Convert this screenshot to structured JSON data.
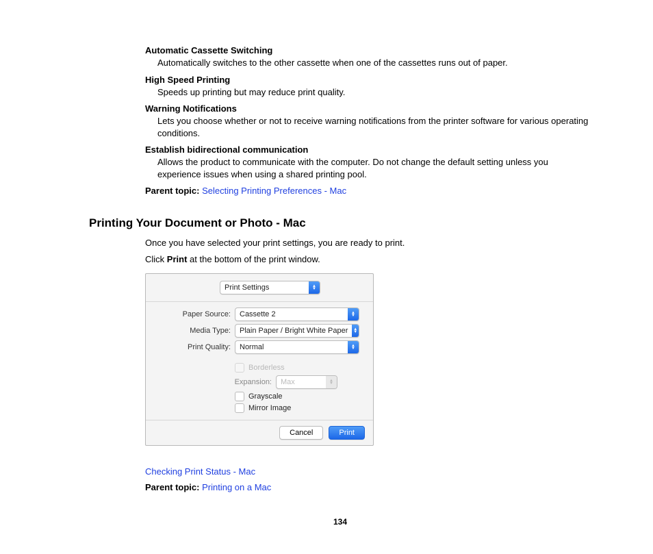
{
  "defs": [
    {
      "term": "Automatic Cassette Switching",
      "desc": "Automatically switches to the other cassette when one of the cassettes runs out of paper."
    },
    {
      "term": "High Speed Printing",
      "desc": "Speeds up printing but may reduce print quality."
    },
    {
      "term": "Warning Notifications",
      "desc": "Lets you choose whether or not to receive warning notifications from the printer software for various operating conditions."
    },
    {
      "term": "Establish bidirectional communication",
      "desc": "Allows the product to communicate with the computer. Do not change the default setting unless you experience issues when using a shared printing pool."
    }
  ],
  "parent1": {
    "label": "Parent topic:",
    "link": "Selecting Printing Preferences - Mac"
  },
  "section_heading": "Printing Your Document or Photo - Mac",
  "intro1": "Once you have selected your print settings, you are ready to print.",
  "intro2_a": "Click ",
  "intro2_b": "Print",
  "intro2_c": " at the bottom of the print window.",
  "dialog": {
    "top_select": "Print Settings",
    "paper_source_label": "Paper Source:",
    "paper_source_value": "Cassette 2",
    "media_type_label": "Media Type:",
    "media_type_value": "Plain Paper / Bright White Paper",
    "print_quality_label": "Print Quality:",
    "print_quality_value": "Normal",
    "borderless": "Borderless",
    "expansion_label": "Expansion:",
    "expansion_value": "Max",
    "grayscale": "Grayscale",
    "mirror": "Mirror Image",
    "cancel": "Cancel",
    "print": "Print"
  },
  "link_status": "Checking Print Status - Mac",
  "parent2": {
    "label": "Parent topic:",
    "link": "Printing on a Mac"
  },
  "page_number": "134"
}
